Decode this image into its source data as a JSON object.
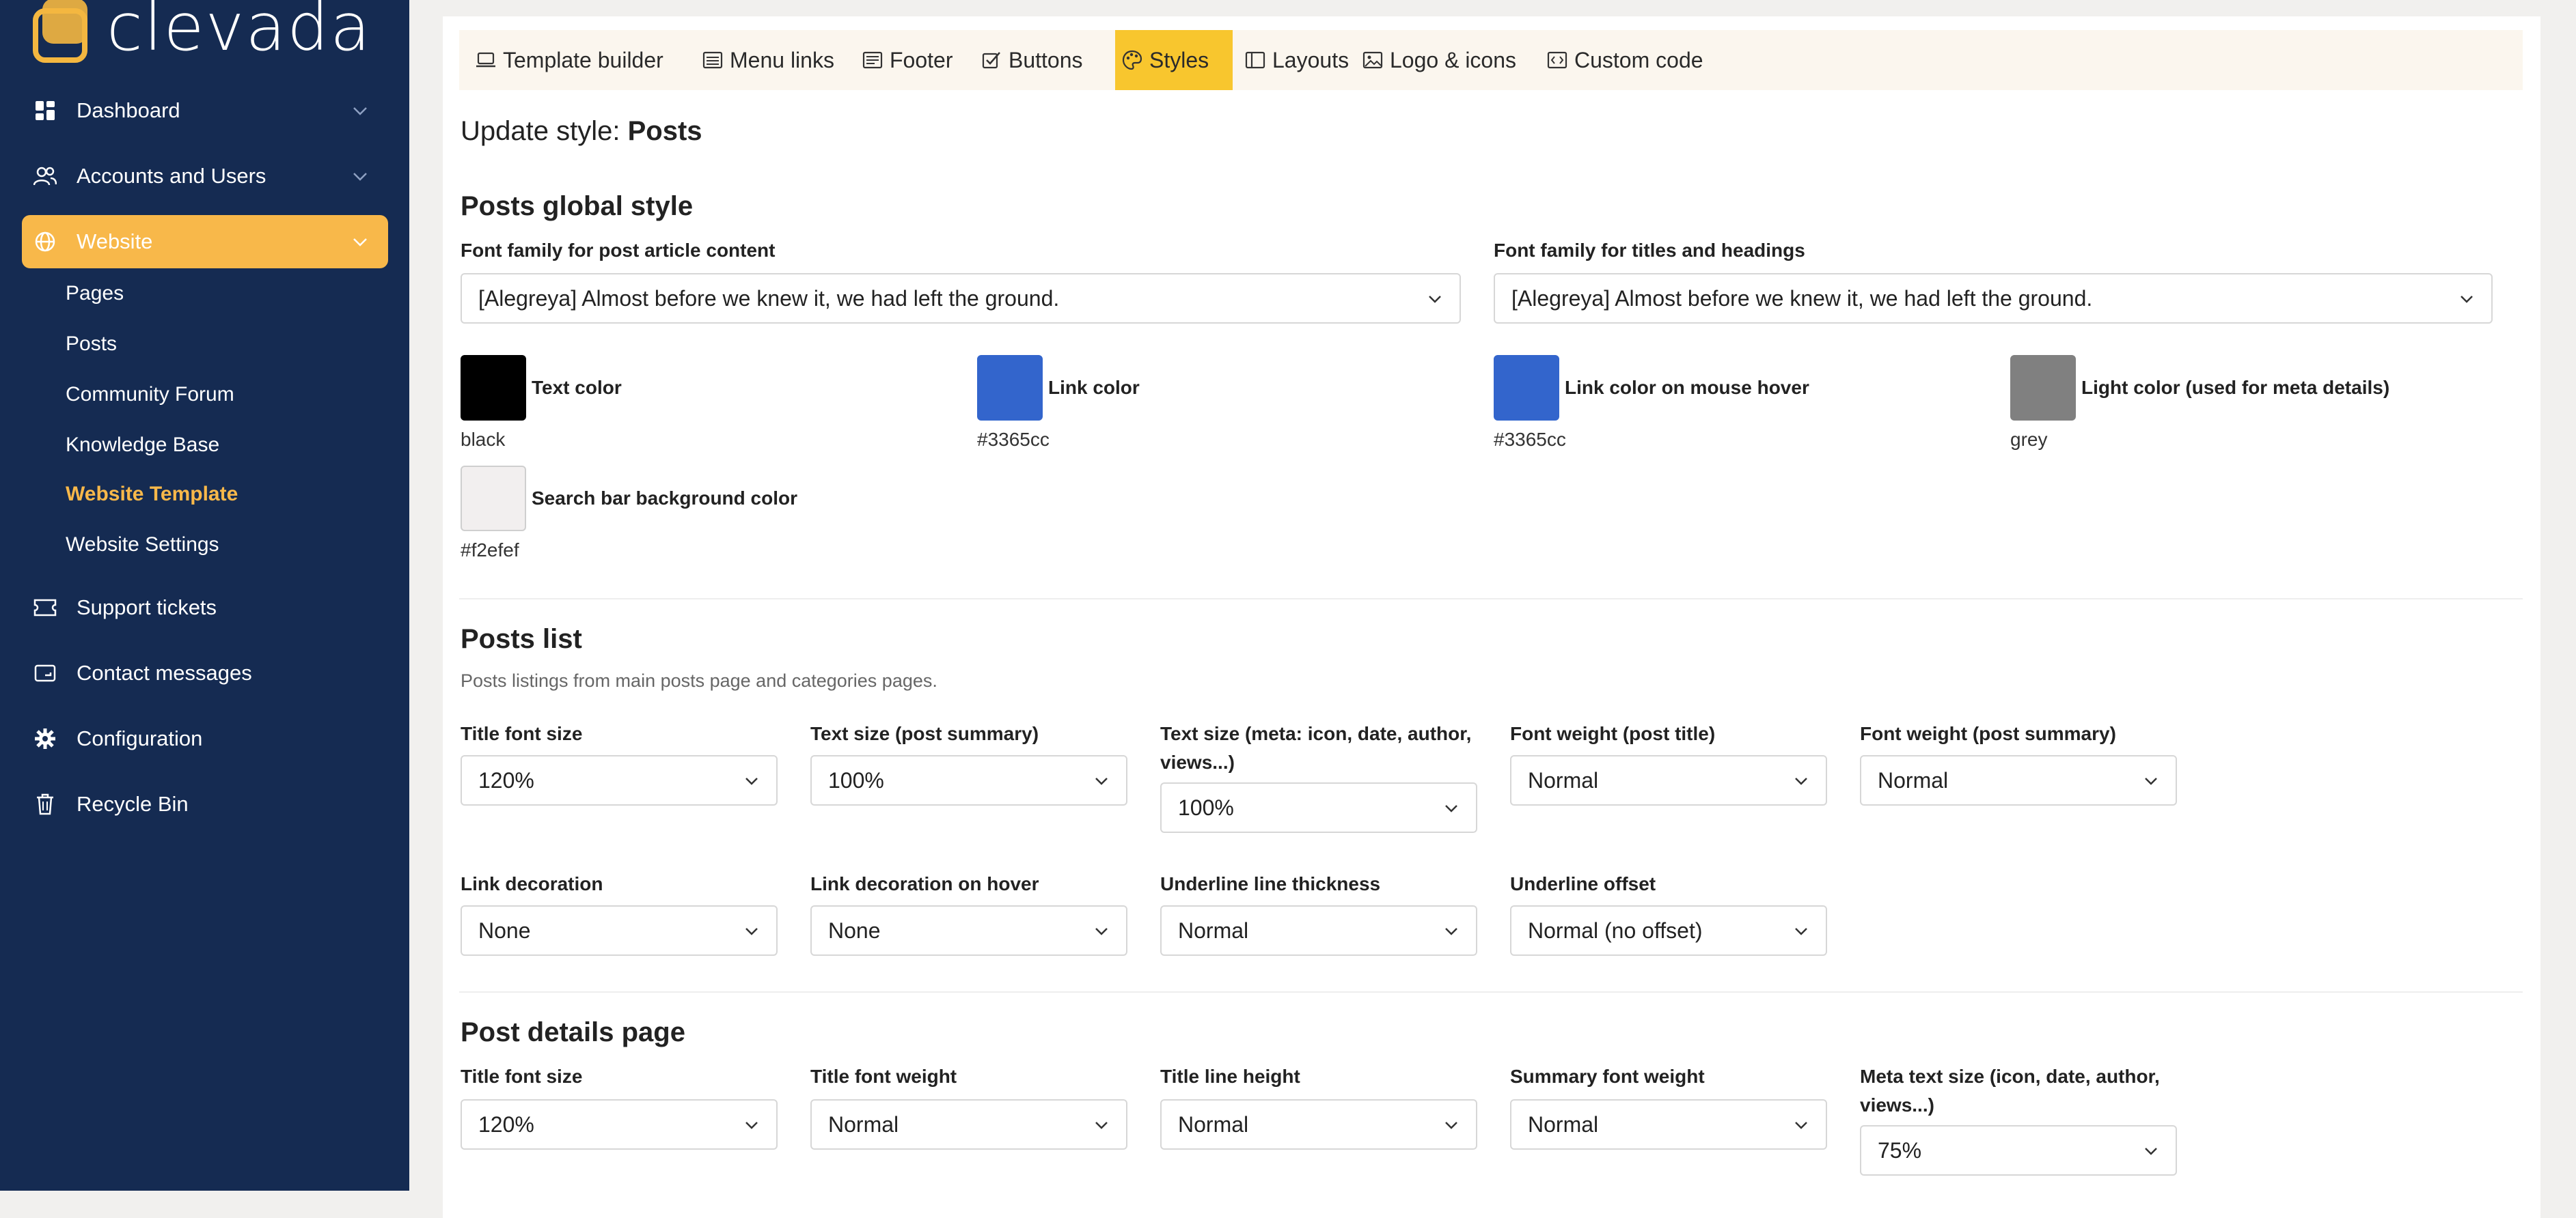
{
  "sidebar": {
    "logo_text": "clevada",
    "items": [
      {
        "label": "Dashboard",
        "icon": "dashboard-icon"
      },
      {
        "label": "Accounts and Users",
        "icon": "users-icon"
      },
      {
        "label": "Website",
        "icon": "globe-icon"
      },
      {
        "label": "Support tickets",
        "icon": "ticket-icon"
      },
      {
        "label": "Contact messages",
        "icon": "inbox-icon"
      },
      {
        "label": "Configuration",
        "icon": "gear-icon"
      },
      {
        "label": "Recycle Bin",
        "icon": "trash-icon"
      }
    ],
    "website_sub": [
      {
        "label": "Pages"
      },
      {
        "label": "Posts"
      },
      {
        "label": "Community Forum"
      },
      {
        "label": "Knowledge Base"
      },
      {
        "label": "Website Template"
      },
      {
        "label": "Website Settings"
      }
    ]
  },
  "tabs": [
    {
      "label": "Template builder",
      "icon": "laptop-icon"
    },
    {
      "label": "Menu links",
      "icon": "menu-icon"
    },
    {
      "label": "Footer",
      "icon": "footer-icon"
    },
    {
      "label": "Buttons",
      "icon": "checkbox-icon"
    },
    {
      "label": "Styles",
      "icon": "palette-icon"
    },
    {
      "label": "Layouts",
      "icon": "layout-icon"
    },
    {
      "label": "Logo & icons",
      "icon": "image-icon"
    },
    {
      "label": "Custom code",
      "icon": "code-icon"
    }
  ],
  "page": {
    "title_prefix": "Update style:",
    "title_name": "Posts"
  },
  "global_style": {
    "title": "Posts global style",
    "font_content_label": "Font family for post article content",
    "font_content_value": "[Alegreya] Almost before we knew it, we had left the ground.",
    "font_titles_label": "Font family for titles and headings",
    "font_titles_value": "[Alegreya] Almost before we knew it, we had left the ground.",
    "colors": [
      {
        "label": "Text color",
        "value": "black",
        "hex": "#000000"
      },
      {
        "label": "Link color",
        "value": "#3365cc",
        "hex": "#3365cc"
      },
      {
        "label": "Link color on mouse hover",
        "value": "#3365cc",
        "hex": "#3365cc"
      },
      {
        "label": "Light color (used for meta details)",
        "value": "grey",
        "hex": "#808080"
      },
      {
        "label": "Search bar background color",
        "value": "#f2efef",
        "hex": "#f2efef"
      }
    ]
  },
  "posts_list": {
    "title": "Posts list",
    "description": "Posts listings from main posts page and categories pages.",
    "fields": [
      {
        "label": "Title font size",
        "value": "120%"
      },
      {
        "label": "Text size (post summary)",
        "value": "100%"
      },
      {
        "label": "Text size (meta: icon, date, author, views...)",
        "value": "100%"
      },
      {
        "label": "Font weight (post title)",
        "value": "Normal"
      },
      {
        "label": "Font weight (post summary)",
        "value": "Normal"
      },
      {
        "label": "Link decoration",
        "value": "None"
      },
      {
        "label": "Link decoration on hover",
        "value": "None"
      },
      {
        "label": "Underline line thickness",
        "value": "Normal"
      },
      {
        "label": "Underline offset",
        "value": "Normal (no offset)"
      }
    ]
  },
  "post_details": {
    "title": "Post details page",
    "fields": [
      {
        "label": "Title font size",
        "value": "120%"
      },
      {
        "label": "Title font weight",
        "value": "Normal"
      },
      {
        "label": "Title line height",
        "value": "Normal"
      },
      {
        "label": "Summary font weight",
        "value": "Normal"
      },
      {
        "label": "Meta text size (icon, date, author, views...)",
        "value": "75%"
      }
    ]
  },
  "colors": {
    "sidebar_bg": "#152b52",
    "accent": "#f8b84a",
    "tab_active": "#f8c62e"
  }
}
